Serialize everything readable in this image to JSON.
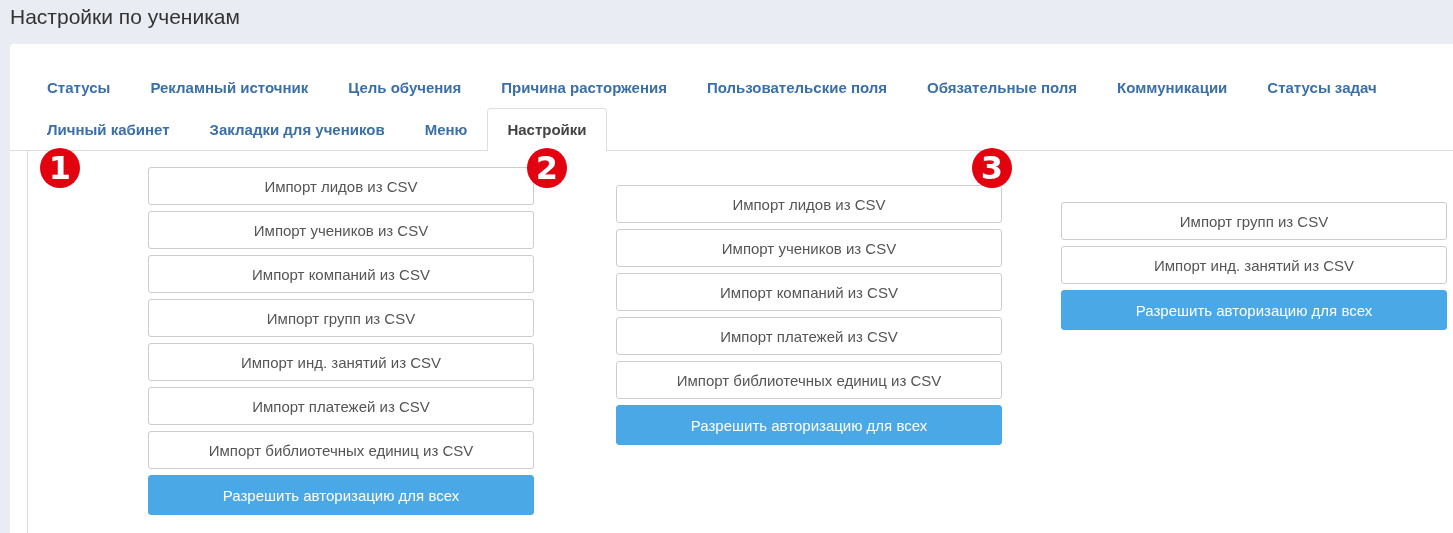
{
  "page_title": "Настройки по ученикам",
  "tab_rows": [
    [
      {
        "label": "Статусы",
        "selected": false
      },
      {
        "label": "Рекламный источник",
        "selected": false
      },
      {
        "label": "Цель обучения",
        "selected": false
      },
      {
        "label": "Причина расторжения",
        "selected": false
      },
      {
        "label": "Пользовательские поля",
        "selected": false
      },
      {
        "label": "Обязательные поля",
        "selected": false
      },
      {
        "label": "Коммуникации",
        "selected": false
      },
      {
        "label": "Статусы задач",
        "selected": false
      }
    ],
    [
      {
        "label": "Личный кабинет",
        "selected": false
      },
      {
        "label": "Закладки для учеников",
        "selected": false
      },
      {
        "label": "Меню",
        "selected": false
      },
      {
        "label": "Настройки",
        "selected": true
      }
    ]
  ],
  "columns": [
    {
      "marker": "1",
      "buttons": [
        {
          "label": "Импорт лидов из CSV",
          "kind": "default"
        },
        {
          "label": "Импорт учеников из CSV",
          "kind": "default"
        },
        {
          "label": "Импорт компаний из CSV",
          "kind": "default"
        },
        {
          "label": "Импорт групп из CSV",
          "kind": "default"
        },
        {
          "label": "Импорт инд. занятий из CSV",
          "kind": "default"
        },
        {
          "label": "Импорт платежей из CSV",
          "kind": "default"
        },
        {
          "label": "Импорт библиотечных единиц из CSV",
          "kind": "default"
        },
        {
          "label": "Разрешить авторизацию для всех",
          "kind": "primary"
        }
      ]
    },
    {
      "marker": "2",
      "buttons": [
        {
          "label": "Импорт лидов из CSV",
          "kind": "default"
        },
        {
          "label": "Импорт учеников из CSV",
          "kind": "default"
        },
        {
          "label": "Импорт компаний из CSV",
          "kind": "default"
        },
        {
          "label": "Импорт платежей из CSV",
          "kind": "default"
        },
        {
          "label": "Импорт библиотечных единиц из CSV",
          "kind": "default"
        },
        {
          "label": "Разрешить авторизацию для всех",
          "kind": "primary"
        }
      ]
    },
    {
      "marker": "3",
      "buttons": [
        {
          "label": "Импорт групп из CSV",
          "kind": "default"
        },
        {
          "label": "Импорт инд. занятий из CSV",
          "kind": "default"
        },
        {
          "label": "Разрешить авторизацию для всех",
          "kind": "primary"
        }
      ]
    }
  ]
}
